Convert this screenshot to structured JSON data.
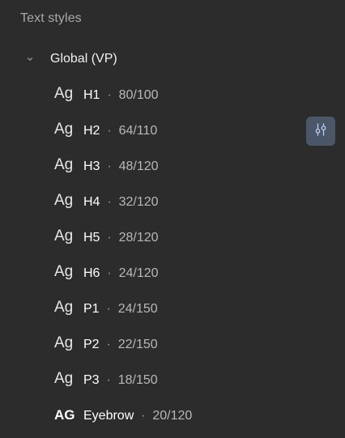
{
  "panel": {
    "title": "Text styles"
  },
  "group": {
    "label": "Global (VP)",
    "expanded": true
  },
  "styles": [
    {
      "preview": "Ag",
      "name": "H1",
      "spec": "80/100",
      "hovered": false
    },
    {
      "preview": "Ag",
      "name": "H2",
      "spec": "64/110",
      "hovered": true
    },
    {
      "preview": "Ag",
      "name": "H3",
      "spec": "48/120",
      "hovered": false
    },
    {
      "preview": "Ag",
      "name": "H4",
      "spec": "32/120",
      "hovered": false
    },
    {
      "preview": "Ag",
      "name": "H5",
      "spec": "28/120",
      "hovered": false
    },
    {
      "preview": "Ag",
      "name": "H6",
      "spec": "24/120",
      "hovered": false
    },
    {
      "preview": "Ag",
      "name": "P1",
      "spec": "24/150",
      "hovered": false
    },
    {
      "preview": "Ag",
      "name": "P2",
      "spec": "22/150",
      "hovered": false
    },
    {
      "preview": "Ag",
      "name": "P3",
      "spec": "18/150",
      "hovered": false
    },
    {
      "preview": "AG",
      "name": "Eyebrow",
      "spec": "20/120",
      "hovered": false
    }
  ],
  "separator": "·",
  "icons": {
    "chevron": "chevron-down-icon",
    "edit": "adjust-sliders-icon"
  },
  "colors": {
    "background": "#2c2c2c",
    "edit_button": "#4c5669",
    "edit_icon": "#b9cdf2"
  }
}
